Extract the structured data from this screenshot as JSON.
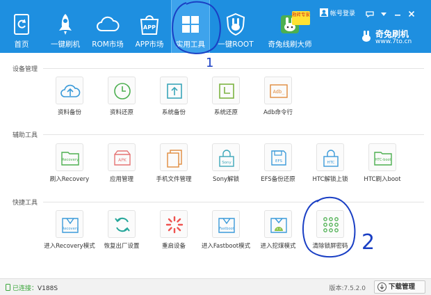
{
  "nav": [
    {
      "label": "首页",
      "icon": "home-icon"
    },
    {
      "label": "一键刷机",
      "icon": "rocket-icon"
    },
    {
      "label": "ROM市场",
      "icon": "cloud-icon"
    },
    {
      "label": "APP市场",
      "icon": "app-bag-icon",
      "badge": "APP"
    },
    {
      "label": "实用工具",
      "icon": "grid-icon",
      "active": true
    },
    {
      "label": "一键ROOT",
      "icon": "rabbit-shield-icon"
    },
    {
      "label": "奇兔线刷大师",
      "icon": "robot-icon",
      "badge": "救砖专家"
    }
  ],
  "topbar": {
    "account_label": "帐号登录",
    "brand_name": "奇兔刷机",
    "brand_url": "www.7to.cn"
  },
  "sections": [
    {
      "title": "设备管理",
      "tools": [
        {
          "label": "资料备份",
          "icon": "cloud-upload-icon",
          "color": "#3a9ad9"
        },
        {
          "label": "资料还原",
          "icon": "clock-icon",
          "color": "#4caf50"
        },
        {
          "label": "系统备份",
          "icon": "upload-box-icon",
          "color": "#3aa6b9"
        },
        {
          "label": "系统还原",
          "icon": "restore-clock-icon",
          "color": "#7cb342"
        },
        {
          "label": "Adb命令行",
          "icon": "terminal-icon",
          "color": "#e08a3c",
          "badge": "Adb_"
        }
      ]
    },
    {
      "title": "辅助工具",
      "tools": [
        {
          "label": "刷入Recovery",
          "icon": "folder-recovery-icon",
          "color": "#4caf50",
          "badge": "Recovery"
        },
        {
          "label": "应用管理",
          "icon": "apk-box-icon",
          "color": "#e57373",
          "badge": "APK"
        },
        {
          "label": "手机文件管理",
          "icon": "files-icon",
          "color": "#e08a3c"
        },
        {
          "label": "Sony解锁",
          "icon": "sony-lock-icon",
          "color": "#3aa6b9",
          "badge": "Sony"
        },
        {
          "label": "EFS备份还原",
          "icon": "efs-disk-icon",
          "color": "#3a9ad9",
          "badge": "EFS"
        },
        {
          "label": "HTC解锁上锁",
          "icon": "htc-lock-icon",
          "color": "#3a9ad9",
          "badge": "HTC"
        },
        {
          "label": "HTC刷入boot",
          "icon": "htc-boot-folder-icon",
          "color": "#4caf50",
          "badge": "HTC-boot"
        }
      ]
    },
    {
      "title": "快捷工具",
      "tools": [
        {
          "label": "进入Recovery模式",
          "icon": "recovery-mode-icon",
          "color": "#3a9ad9",
          "badge": "Recovery"
        },
        {
          "label": "恢复出厂设置",
          "icon": "refresh-icon",
          "color": "#26a69a"
        },
        {
          "label": "重启设备",
          "icon": "loading-spinner-icon",
          "color": "#ef5350"
        },
        {
          "label": "进入Fastboot模式",
          "icon": "fastboot-mode-icon",
          "color": "#3a9ad9",
          "badge": "Fastboot"
        },
        {
          "label": "进入挖煤模式",
          "icon": "android-download-icon",
          "color": "#3a9ad9"
        },
        {
          "label": "清除锁屏密码",
          "icon": "pattern-lock-icon",
          "color": "#4caf50"
        }
      ]
    }
  ],
  "annotations": [
    "1",
    "2"
  ],
  "status": {
    "connected_label": "已连接：",
    "device": "V188S",
    "version": "版本:7.5.2.0",
    "download_label": "下载管理"
  }
}
